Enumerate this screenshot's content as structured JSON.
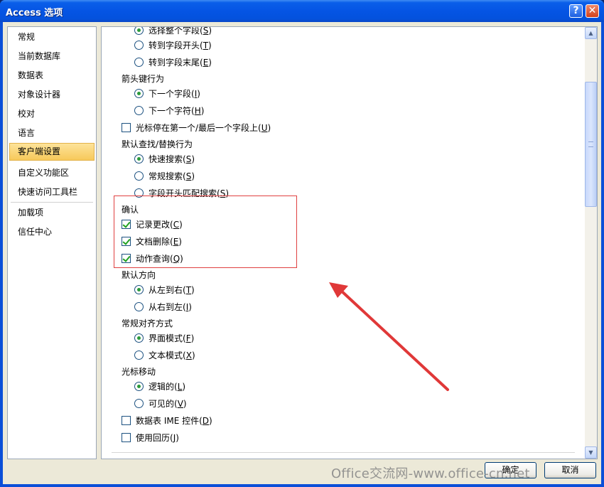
{
  "window": {
    "title": "Access 选项",
    "help_glyph": "?",
    "close_glyph": "✕"
  },
  "nav": {
    "items": [
      {
        "label": "常规"
      },
      {
        "label": "当前数据库"
      },
      {
        "label": "数据表"
      },
      {
        "label": "对象设计器"
      },
      {
        "label": "校对"
      },
      {
        "label": "语言"
      },
      {
        "label": "客户端设置",
        "selected": true
      },
      {
        "label": "自定义功能区"
      },
      {
        "label": "快速访问工具栏"
      },
      {
        "label": "加载项"
      },
      {
        "label": "信任中心"
      }
    ]
  },
  "options": {
    "select_whole_field": {
      "label": "选择整个字段",
      "key": "S",
      "checked": true
    },
    "go_to_start": {
      "label": "转到字段开头",
      "key": "T",
      "checked": false
    },
    "go_to_end": {
      "label": "转到字段末尾",
      "key": "E",
      "checked": false
    },
    "arrow_key_title": "箭头键行为",
    "next_field": {
      "label": "下一个字段",
      "key": "I",
      "checked": true
    },
    "next_char": {
      "label": "下一个字符",
      "key": "H",
      "checked": false
    },
    "cursor_stops": {
      "label": "光标停在第一个/最后一个字段上",
      "key": "U",
      "checked": false
    },
    "find_replace_title": "默认查找/替换行为",
    "fast_search": {
      "label": "快速搜索",
      "key": "S",
      "checked": true
    },
    "general_search": {
      "label": "常规搜索",
      "key": "S",
      "checked": false
    },
    "start_match_search": {
      "label": "字段开头匹配搜索",
      "key": "S",
      "checked": false
    },
    "confirm_title": "确认",
    "record_changes": {
      "label": "记录更改",
      "key": "C",
      "checked": true
    },
    "document_deletions": {
      "label": "文档删除",
      "key": "E",
      "checked": true
    },
    "action_queries": {
      "label": "动作查询",
      "key": "Q",
      "checked": true
    },
    "direction_title": "默认方向",
    "ltr": {
      "label": "从左到右",
      "key": "T",
      "checked": true
    },
    "rtl": {
      "label": "从右到左",
      "key": "I",
      "checked": false
    },
    "alignment_title": "常规对齐方式",
    "interface_mode": {
      "label": "界面模式",
      "key": "F",
      "checked": true
    },
    "text_mode": {
      "label": "文本模式",
      "key": "X",
      "checked": false
    },
    "cursor_move_title": "光标移动",
    "logical": {
      "label": "逻辑的",
      "key": "L",
      "checked": true
    },
    "visual": {
      "label": "可见的",
      "key": "V",
      "checked": false
    },
    "datasheet_ime": {
      "label": "数据表 IME 控件",
      "key": "D",
      "checked": false
    },
    "use_hijri": {
      "label": "使用回历",
      "key": "J",
      "checked": false
    }
  },
  "buttons": {
    "ok": "确定",
    "cancel": "取消"
  },
  "scrollbar": {
    "up_glyph": "▲",
    "down_glyph": "▼"
  },
  "watermark": "Office交流网-www.office-cn.net",
  "colors": {
    "highlight_box": "#e04040",
    "arrow": "#e03838",
    "selected_nav": "#f7c95a"
  }
}
